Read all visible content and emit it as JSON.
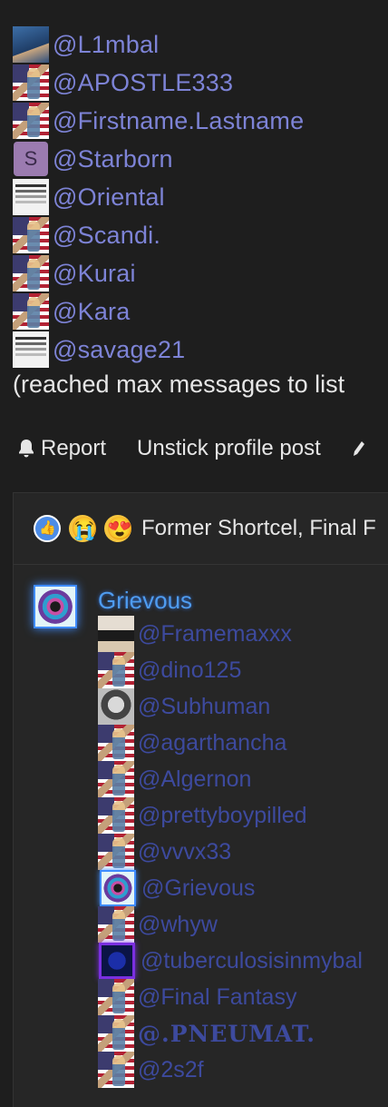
{
  "mentions": [
    {
      "name": "@L1mbal",
      "avatar": "photo-blue"
    },
    {
      "name": "@APOSTLE333",
      "avatar": "flag"
    },
    {
      "name": "@Firstname.Lastname",
      "avatar": "flag"
    },
    {
      "name": "@Starborn",
      "avatar": "letter",
      "letter": "S"
    },
    {
      "name": "@Oriental",
      "avatar": "screenshot"
    },
    {
      "name": "@Scandi.",
      "avatar": "flag"
    },
    {
      "name": "@Kurai",
      "avatar": "flag"
    },
    {
      "name": "@Kara",
      "avatar": "flag"
    },
    {
      "name": "@savage21",
      "avatar": "screenshot"
    }
  ],
  "max_note": "(reached max messages to list",
  "actions": {
    "report": "Report",
    "unstick": "Unstick profile post"
  },
  "reaction_bar": {
    "icons": [
      "like-icon",
      "cry-icon",
      "heart-eyes-icon"
    ],
    "text": "Former Shortcel, Final F"
  },
  "post": {
    "author": "Grievous",
    "likers": [
      {
        "name": "@Framemaxxx",
        "avatar": "sport"
      },
      {
        "name": "@dino125",
        "avatar": "flag"
      },
      {
        "name": "@Subhuman",
        "avatar": "bw"
      },
      {
        "name": "@agarthancha",
        "avatar": "flag"
      },
      {
        "name": "@Algernon",
        "avatar": "flag"
      },
      {
        "name": "@prettyboypilled",
        "avatar": "flag"
      },
      {
        "name": "@vvvx33",
        "avatar": "flag"
      },
      {
        "name": "@Grievous",
        "avatar": "glow"
      },
      {
        "name": "@whyw",
        "avatar": "flag"
      },
      {
        "name": "@tuberculosisinmybal",
        "avatar": "purple"
      },
      {
        "name": "@Final Fantasy",
        "avatar": "flag"
      },
      {
        "name": "@.PNEUMAT.",
        "avatar": "flag",
        "style": "serif"
      },
      {
        "name": "@2s2f",
        "avatar": "flag"
      }
    ]
  },
  "colors": {
    "background": "#1e1e1e",
    "mention_link": "#7d83d6",
    "liker_link": "#3d4a9e",
    "author_glow": "#4f9cf0"
  }
}
